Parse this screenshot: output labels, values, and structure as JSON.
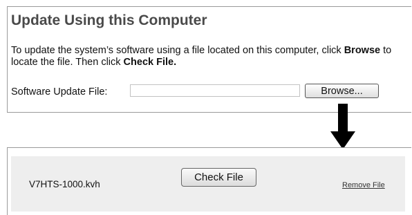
{
  "update_panel": {
    "title": "Update Using this Computer",
    "instruction_part1": "To update the system’s software using a file located on this computer, click ",
    "instruction_browse_word": "Browse",
    "instruction_part2": " to locate the file. Then click ",
    "instruction_check_word": "Check File.",
    "file_label": "Software Update File:",
    "file_value": "",
    "browse_label": "Browse..."
  },
  "file_panel": {
    "file_name": "V7HTS-1000.kvh",
    "check_label": "Check File",
    "remove_label": "Remove File"
  },
  "colors": {
    "title": "#4a4a4a",
    "strip_background": "#eeeeee",
    "border": "#9a9a9a"
  },
  "icons": {
    "arrow": "arrow-down-icon"
  }
}
